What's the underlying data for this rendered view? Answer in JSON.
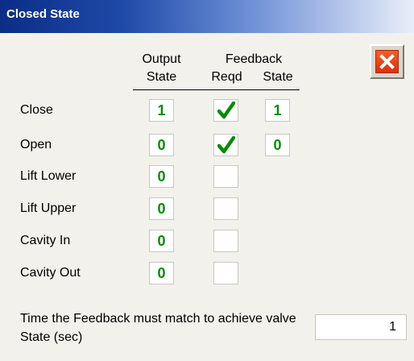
{
  "window": {
    "title": "Closed State"
  },
  "headers": {
    "output_line1": "Output",
    "output_line2": "State",
    "feedback": "Feedback",
    "reqd": "Reqd",
    "state": "State"
  },
  "close_button": {
    "icon": "close-icon"
  },
  "rows": [
    {
      "label": "Close",
      "output": "1",
      "reqd": true,
      "state": "1"
    },
    {
      "label": "Open",
      "output": "0",
      "reqd": true,
      "state": "0"
    },
    {
      "label": "Lift Lower",
      "output": "0",
      "reqd": false,
      "state": ""
    },
    {
      "label": "Lift Upper",
      "output": "0",
      "reqd": false,
      "state": ""
    },
    {
      "label": "Cavity In",
      "output": "0",
      "reqd": false,
      "state": ""
    },
    {
      "label": "Cavity Out",
      "output": "0",
      "reqd": false,
      "state": ""
    }
  ],
  "footer": {
    "text": "Time the Feedback must match to achieve valve State (sec)",
    "value": "1"
  },
  "colors": {
    "value_green": "#0a8a0a",
    "title_bar": "#0b2d86",
    "close_red": "#e2451c"
  }
}
